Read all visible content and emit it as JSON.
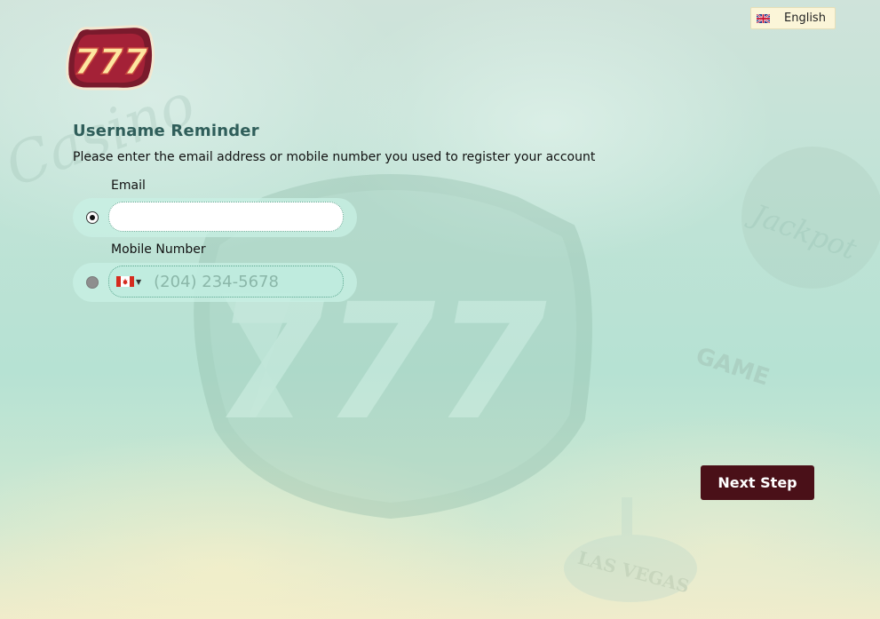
{
  "language": {
    "label": "English",
    "flag_icon": "uk-flag-icon"
  },
  "logo": {
    "text": "777"
  },
  "form": {
    "title": "Username Reminder",
    "subtitle": "Please enter the email address or mobile number you used to register your account",
    "email": {
      "label": "Email",
      "value": "",
      "placeholder": "",
      "selected": true
    },
    "mobile": {
      "label": "Mobile Number",
      "placeholder": "(204) 234-5678",
      "country_icon": "canada-flag-icon",
      "selected": false
    }
  },
  "actions": {
    "next_label": "Next Step"
  },
  "colors": {
    "title": "#2f5e5a",
    "button": "#4a1018",
    "language_bg": "#fbf5d8"
  }
}
